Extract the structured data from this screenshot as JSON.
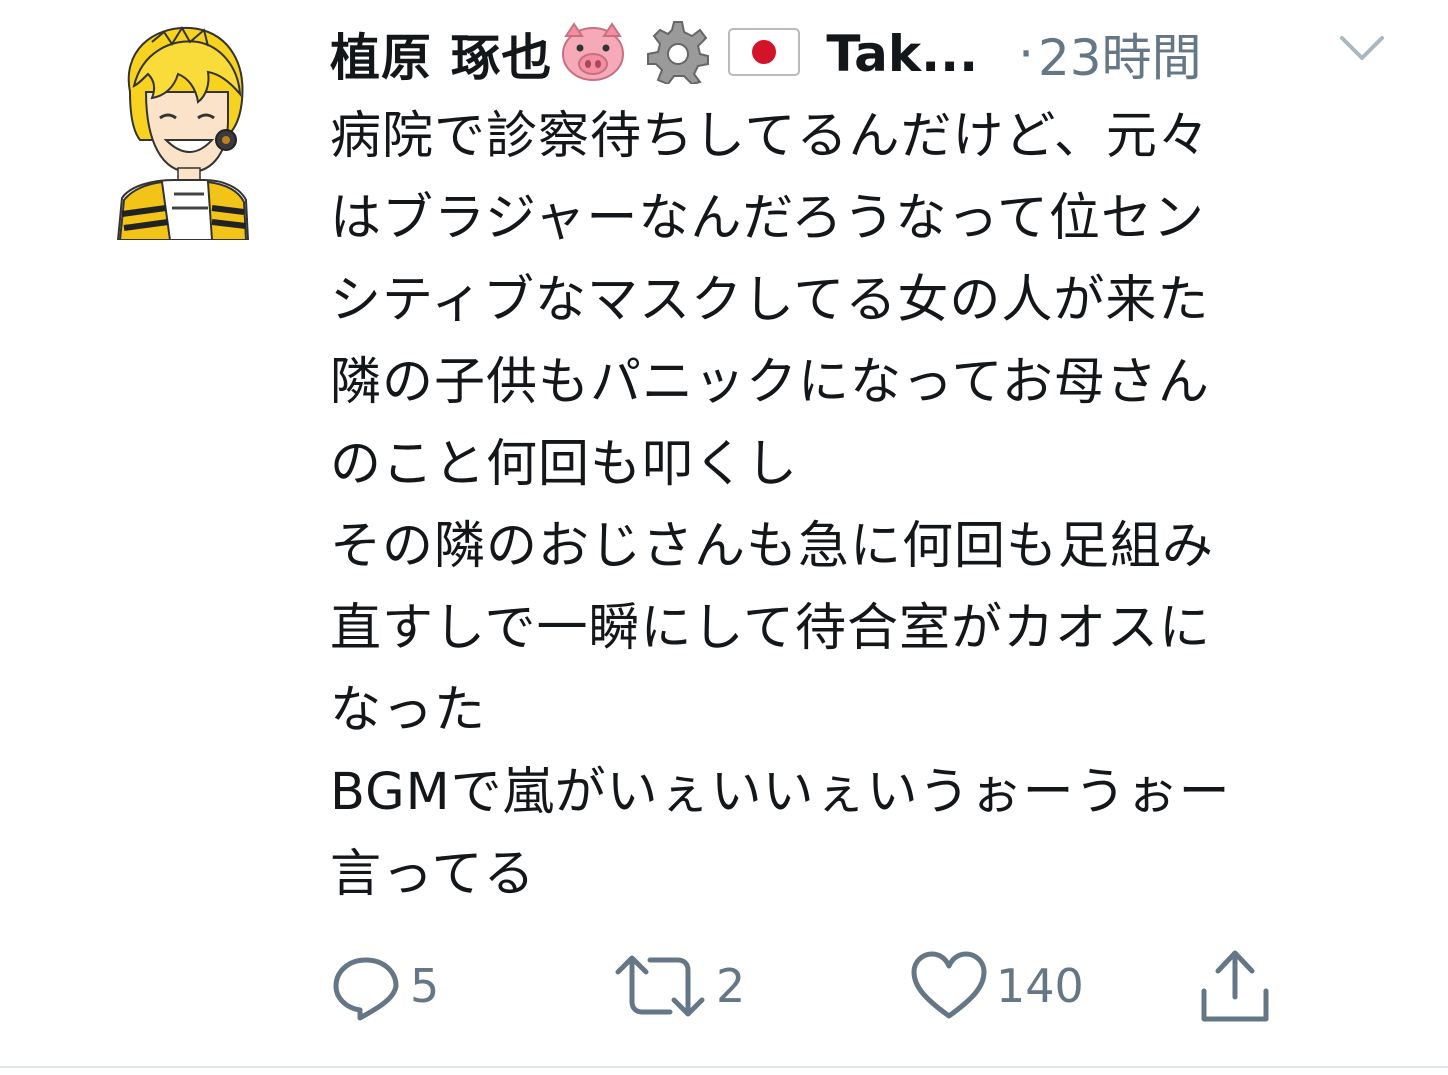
{
  "tweet": {
    "display_name": "植原 琢也",
    "name_emojis": [
      "pig-face-emoji",
      "gear-emoji",
      "japan-flag-emoji"
    ],
    "handle": "Tak...",
    "separator": "·",
    "time": "23時間",
    "body": "病院で診察待ちしてるんだけど、元々\nはブラジャーなんだろうなって位セン\nシティブなマスクしてる女の人が来た\n隣の子供もパニックになってお母さん\nのこと何回も叩くし\nその隣のおじさんも急に何回も足組み\n直すしで一瞬にして待合室がカオスに\nなった\nBGMで嵐がいぇいいぇいうぉーうぉー\n言ってる",
    "actions": {
      "reply_icon": "reply-icon",
      "reply_count": "5",
      "retweet_icon": "retweet-icon",
      "retweet_count": "2",
      "like_icon": "heart-icon",
      "like_count": "140",
      "share_icon": "share-icon"
    },
    "menu_icon": "chevron-down-icon"
  },
  "colors": {
    "text": "#14171a",
    "secondary": "#657786",
    "border": "#e1e8ed",
    "avatar_hair": "#f5d020"
  }
}
